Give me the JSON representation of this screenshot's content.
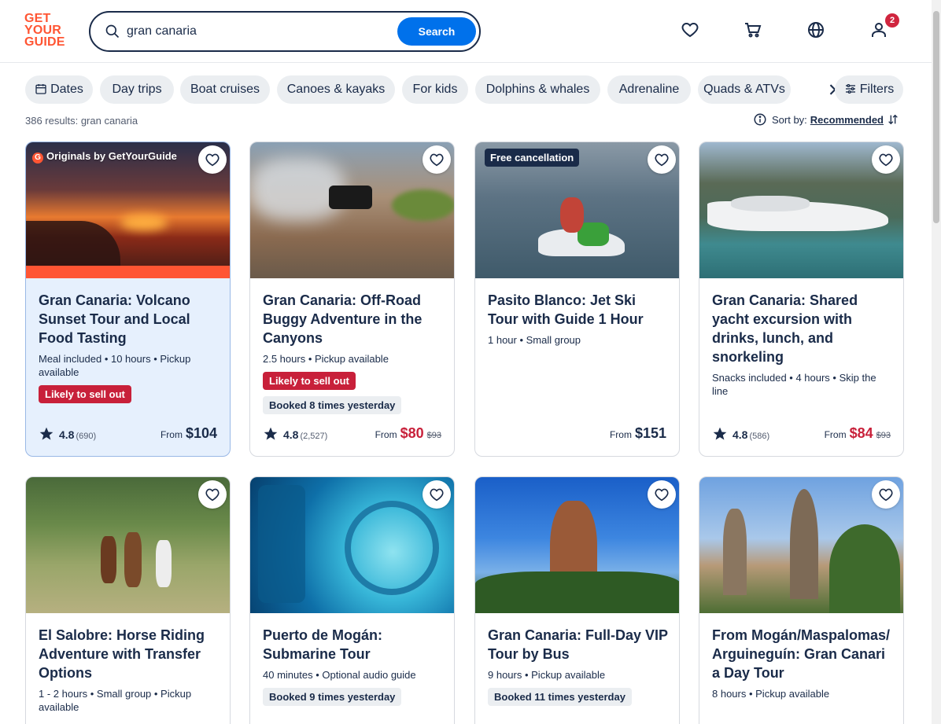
{
  "header": {
    "logo_lines": [
      "GET",
      "YOUR",
      "GUIDE"
    ],
    "search_value": "gran canaria",
    "search_button": "Search",
    "cart_badge": "2",
    "icons": [
      "heart-icon",
      "cart-icon",
      "globe-icon",
      "profile-icon"
    ]
  },
  "chips": [
    "Dates",
    "Day trips",
    "Boat cruises",
    "Canoes & kayaks",
    "For kids",
    "Dolphins & whales",
    "Adrenaline",
    "Quads & ATVs"
  ],
  "filters_label": "Filters",
  "results_text": "386 results: gran canaria",
  "sort": {
    "label": "Sort by:",
    "value": "Recommended"
  },
  "cards": [
    {
      "tag": "Originals by GetYourGuide",
      "tag_logo": "G",
      "title": "Gran Canaria: Volcano Sunset Tour and Local Food Tasting",
      "meta": "Meal included • 10 hours • Pickup available",
      "badges": [
        "Likely to sell out"
      ],
      "rating": "4.8",
      "reviews": "(690)",
      "price_from": "From",
      "price": "$104"
    },
    {
      "title": "Gran Canaria: Off-Road Buggy Adventure in the Canyons",
      "meta": "2.5 hours • Pickup available",
      "badges": [
        "Likely to sell out",
        "Booked 8 times yesterday"
      ],
      "rating": "4.8",
      "reviews": "(2,527)",
      "price_from": "From",
      "price": "$80",
      "old_price": "$93"
    },
    {
      "tag": "Free cancellation",
      "title": "Pasito Blanco: Jet Ski Tour with Guide 1 Hour",
      "meta": "1 hour • Small group",
      "price_from": "From",
      "price": "$151"
    },
    {
      "title": "Gran Canaria: Shared yacht excursion with drinks, lunch, and snorkeling",
      "meta": "Snacks included • 4 hours • Skip the line",
      "rating": "4.8",
      "reviews": "(586)",
      "price_from": "From",
      "price": "$84",
      "old_price": "$93"
    },
    {
      "title": "El Salobre: Horse Riding Adventure with Transfer Options",
      "meta": "1 - 2 hours • Small group • Pickup available"
    },
    {
      "title": "Puerto de Mogán: Submarine Tour",
      "meta": "40 minutes • Optional audio guide",
      "badges": [
        "Booked 9 times yesterday"
      ]
    },
    {
      "title": "Gran Canaria: Full-Day VIP Tour by Bus",
      "meta": "9 hours • Pickup available",
      "badges": [
        "Booked 11 times yesterday"
      ]
    },
    {
      "title": "From Mogán/Maspalomas/Arguineguín: Gran Canaria Day Tour",
      "meta": "8 hours • Pickup available"
    }
  ],
  "colors": {
    "brand": "#ff5533",
    "primary": "#0071eb",
    "sale": "#c8203a",
    "navy": "#1a2b49"
  }
}
